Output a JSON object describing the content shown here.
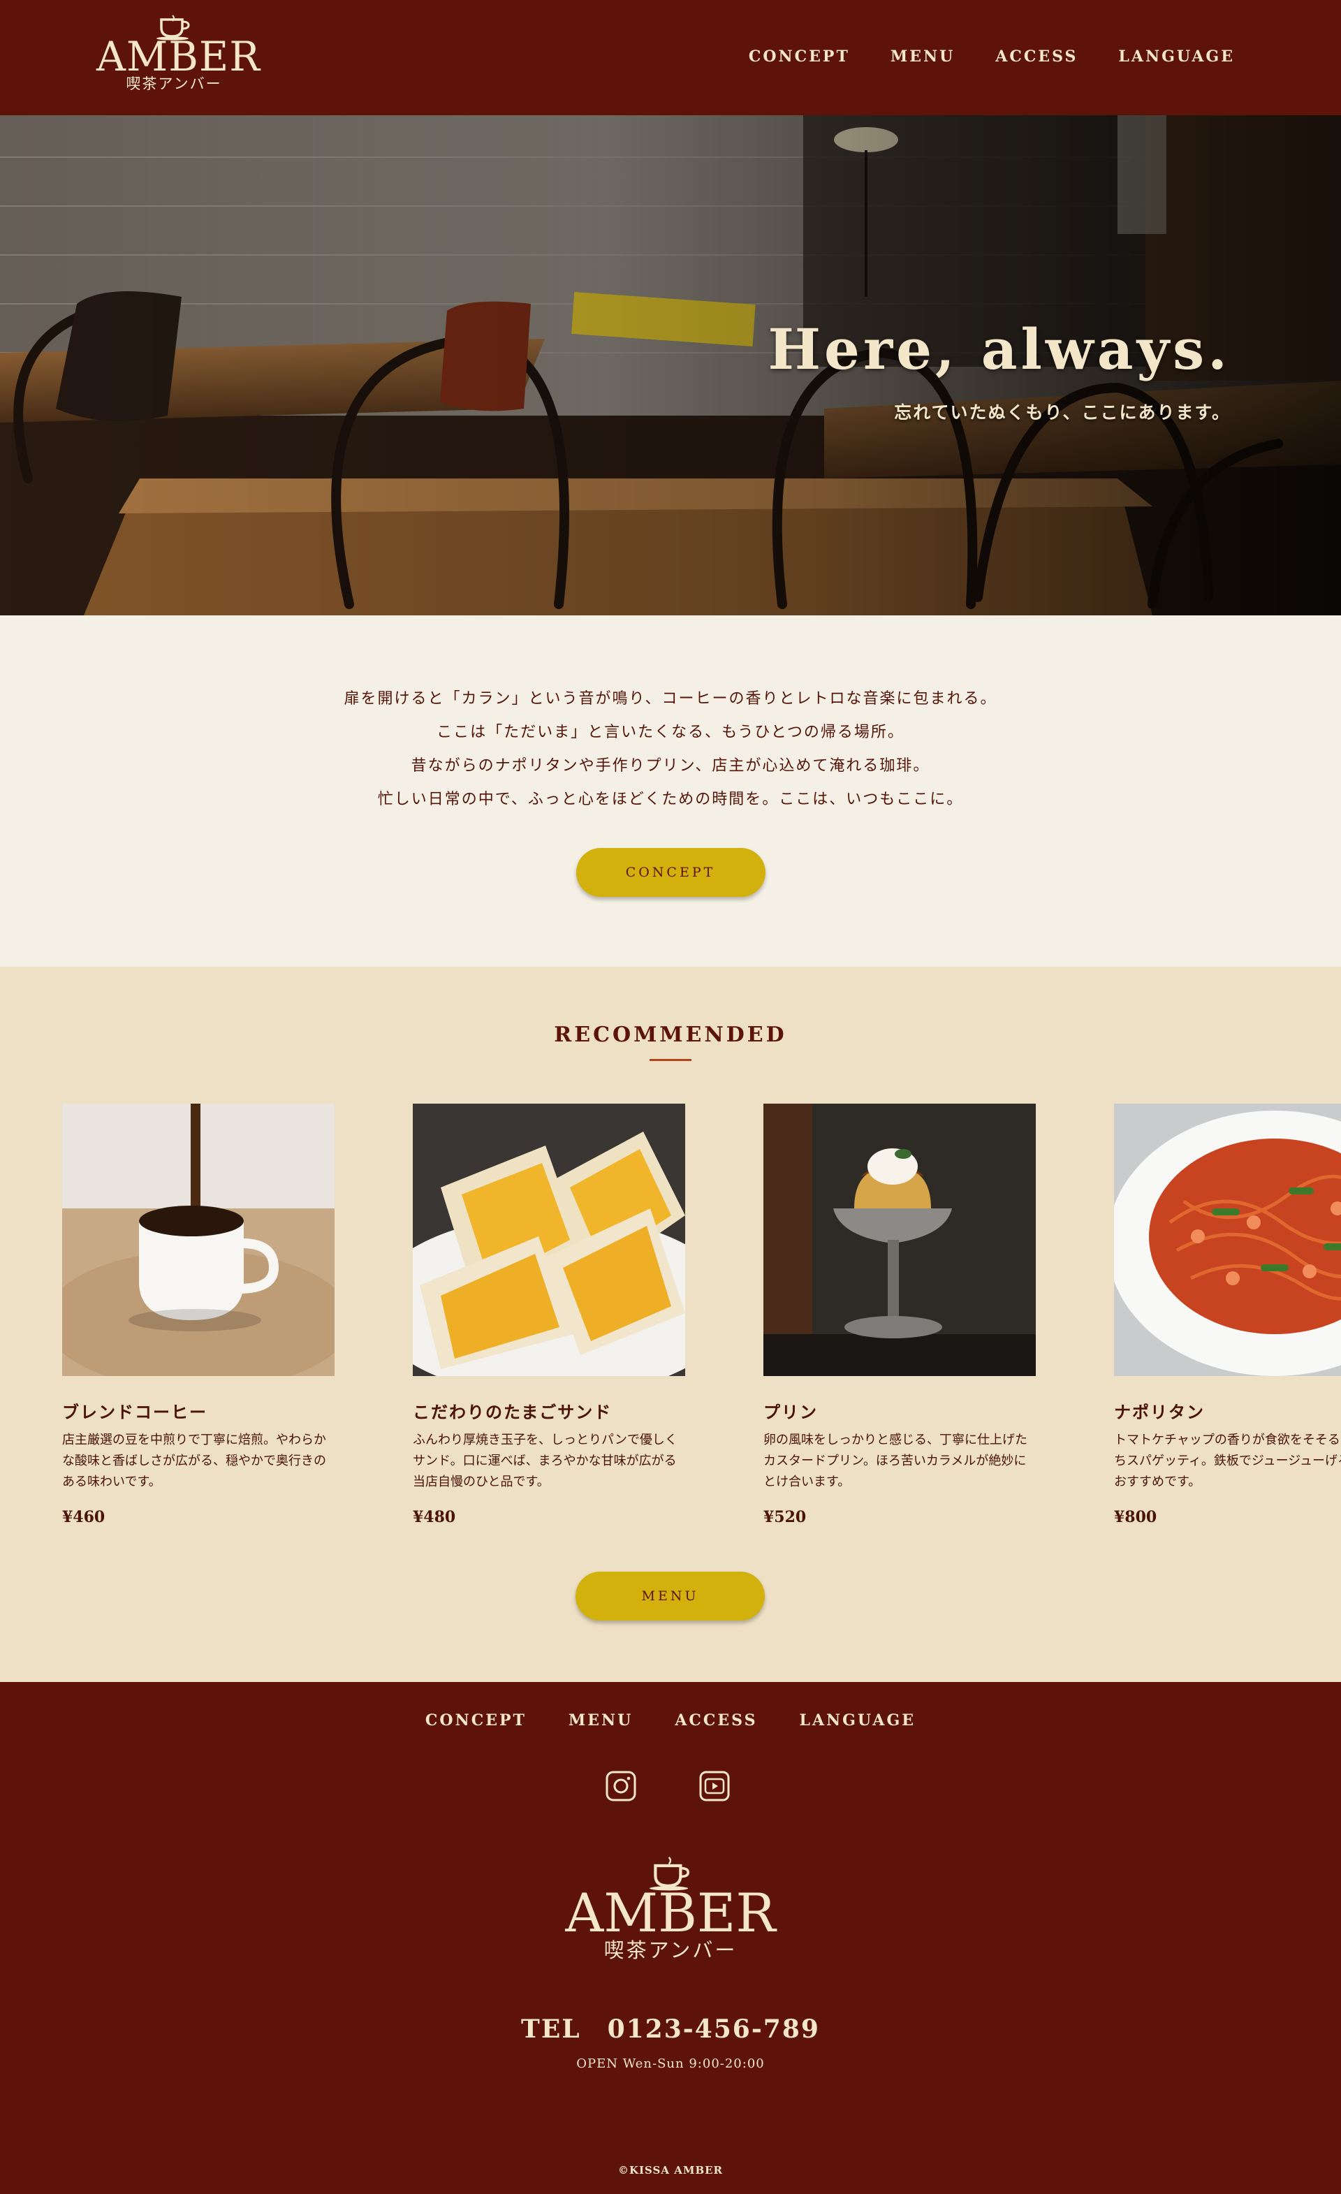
{
  "brand": {
    "name": "AMBER",
    "subtitle": "喫茶アンバー"
  },
  "nav": {
    "items": [
      "CONCEPT",
      "MENU",
      "ACCESS",
      "LANGUAGE"
    ]
  },
  "hero": {
    "title": "Here, always.",
    "subtitle": "忘れていたぬくもり、ここにあります。"
  },
  "intro": {
    "lines": [
      "扉を開けると「カラン」という音が鳴り、コーヒーの香りとレトロな音楽に包まれる。",
      "ここは「ただいま」と言いたくなる、もうひとつの帰る場所。",
      "昔ながらのナポリタンや手作りプリン、店主が心込めて淹れる珈琲。",
      "忙しい日常の中で、ふっと心をほどくための時間を。ここは、いつもここに。"
    ],
    "button": "CONCEPT"
  },
  "recommended": {
    "title": "RECOMMENDED",
    "items": [
      {
        "name": "ブレンドコーヒー",
        "desc": "店主厳選の豆を中煎りで丁寧に焙煎。やわらかな酸味と香ばしさが広がる、穏やかで奥行きのある味わいです。",
        "price": "¥460",
        "image": "coffee-cup"
      },
      {
        "name": "こだわりのたまごサンド",
        "desc": "ふんわり厚焼き玉子を、しっとりパンで優しくサンド。口に運べば、まろやかな甘味が広がる当店自慢のひと品です。",
        "price": "¥480",
        "image": "egg-sandwich"
      },
      {
        "name": "プリン",
        "desc": "卵の風味をしっかりと感じる、丁寧に仕上げたカスタードプリン。ほろ苦いカラメルが絶妙にとけ合います。",
        "price": "¥520",
        "image": "custard-pudding"
      },
      {
        "name": "ナポリタン",
        "desc": "トマトケチャップの香りが食欲をそそるもちもちスパゲッティ。鉄板でジュージューげるのもおすすめです。",
        "price": "¥800",
        "image": "napolitan-pasta"
      }
    ],
    "button": "MENU"
  },
  "footer": {
    "nav": [
      "CONCEPT",
      "MENU",
      "ACCESS",
      "LANGUAGE"
    ],
    "social": [
      "instagram-icon",
      "youtube-icon"
    ],
    "tel": "TEL　0123-456-789",
    "hours": "OPEN Wen-Sun 9:00-20:00",
    "copyright": "©KISSA AMBER"
  },
  "colors": {
    "header_bg": "#5e1309",
    "cream": "#f3e6c9",
    "intro_bg": "#f5f0e6",
    "recommended_bg": "#ede0c5",
    "button": "#d3b10d",
    "accent_line": "#b4441a"
  }
}
